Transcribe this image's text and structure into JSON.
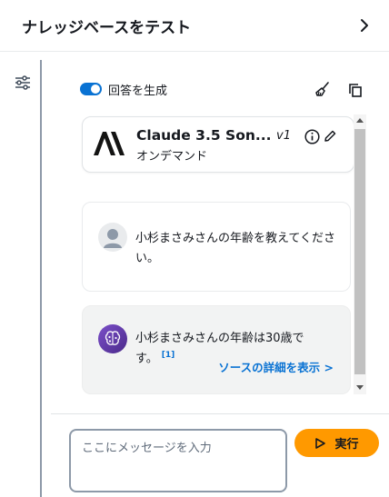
{
  "header": {
    "title": "ナレッジベースをテスト",
    "chevron_icon": "chevron-right-icon"
  },
  "left_rail": {
    "settings_icon": "sliders-icon"
  },
  "toolbar": {
    "toggle_label": "回答を生成",
    "toggle_on": true,
    "broom_icon": "broom-icon",
    "copy_icon": "copy-icon"
  },
  "model": {
    "name": "Claude 3.5 Son...",
    "version": "v1",
    "mode": "オンデマンド",
    "logo": "anthropic-logo",
    "info_icon": "info-icon",
    "edit_icon": "pencil-icon"
  },
  "messages": [
    {
      "role": "user",
      "avatar": "user-avatar",
      "text": "小杉まさみさんの年齢を教えてください。"
    },
    {
      "role": "assistant",
      "avatar": "ai-brain-avatar",
      "text": "小杉まさみさんの年齢は30歳です。",
      "citation": "[1]",
      "source_link": "ソースの詳細を表示 >"
    }
  ],
  "composer": {
    "placeholder": "ここにメッセージを入力",
    "value": "",
    "run_label": "実行",
    "run_icon": "play-icon"
  },
  "colors": {
    "accent_blue": "#0972d3",
    "run_orange": "#ff9900",
    "ai_bubble": "#f2f3f3",
    "ai_avatar": "#6b3fa0"
  }
}
